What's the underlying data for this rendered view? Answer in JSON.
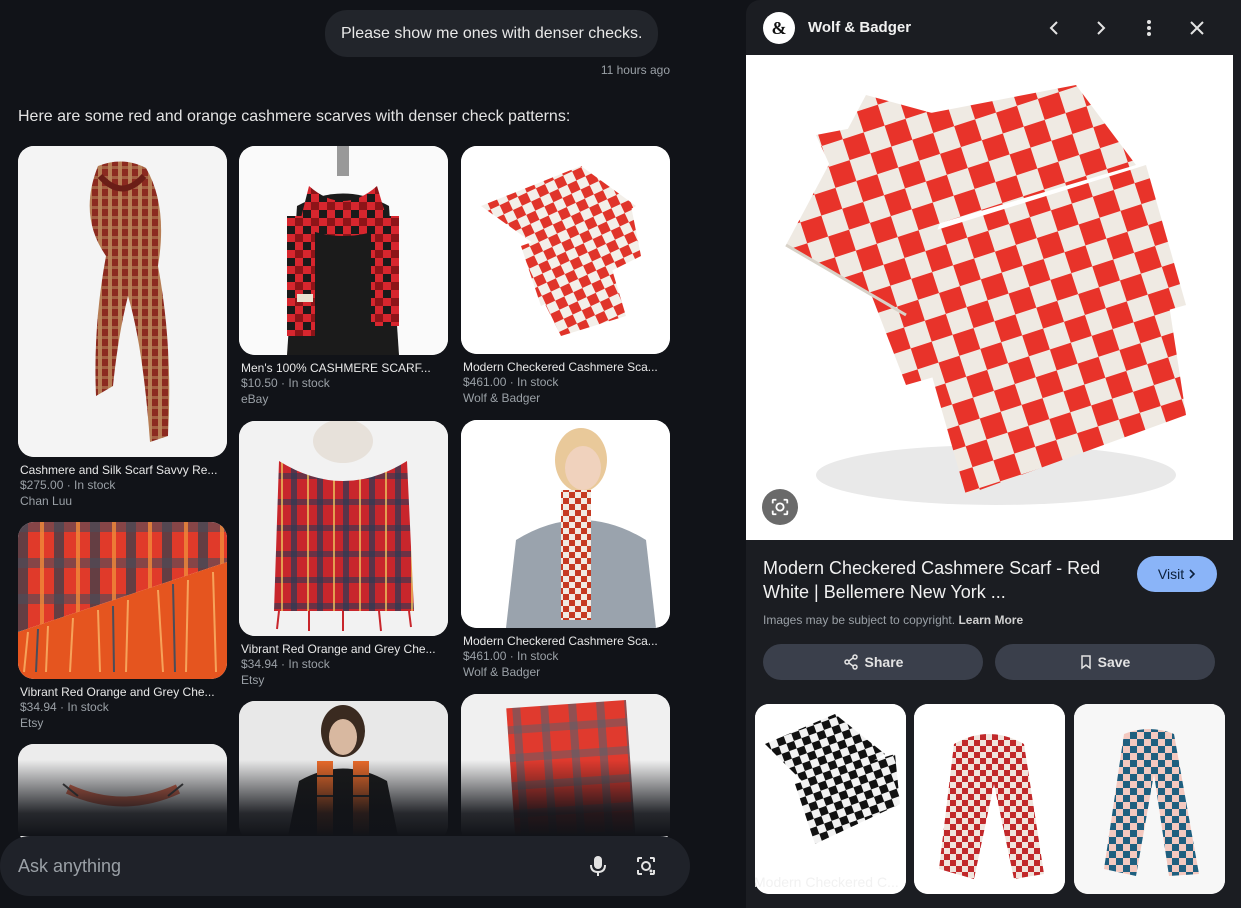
{
  "chat": {
    "user_message": "Please show me ones with denser checks.",
    "user_time": "11 hours ago",
    "intro": "Here are some red and orange cashmere scarves with denser check patterns:"
  },
  "results": [
    {
      "title": "Cashmere and Silk Scarf Savvy Re...",
      "meta": "$275.00 · In stock",
      "source": "Chan Luu"
    },
    {
      "title": "Men's 100% CASHMERE SCARF...",
      "meta": "$10.50 · In stock",
      "source": "eBay"
    },
    {
      "title": "Modern Checkered Cashmere Sca...",
      "meta": "$461.00 · In stock",
      "source": "Wolf & Badger"
    },
    {
      "title": "Vibrant Red Orange and Grey Che...",
      "meta": "$34.94 · In stock",
      "source": "Etsy"
    },
    {
      "title": "Vibrant Red Orange and Grey Che...",
      "meta": "$34.94 · In stock",
      "source": "Etsy"
    },
    {
      "title": "Modern Checkered Cashmere Sca...",
      "meta": "$461.00 · In stock",
      "source": "Wolf & Badger"
    }
  ],
  "ask": {
    "placeholder": "Ask anything"
  },
  "panel": {
    "site_name": "Wolf & Badger",
    "logo_text": "&",
    "title": "Modern Checkered Cashmere Scarf - Red White | Bellemere New York ...",
    "visit_label": "Visit",
    "copyright": "Images may be subject to copyright.",
    "learn_more": "Learn More",
    "share_label": "Share",
    "save_label": "Save",
    "related": [
      {
        "label": "Modern Checkered C..."
      },
      {
        "label": ""
      },
      {
        "label": ""
      }
    ]
  }
}
